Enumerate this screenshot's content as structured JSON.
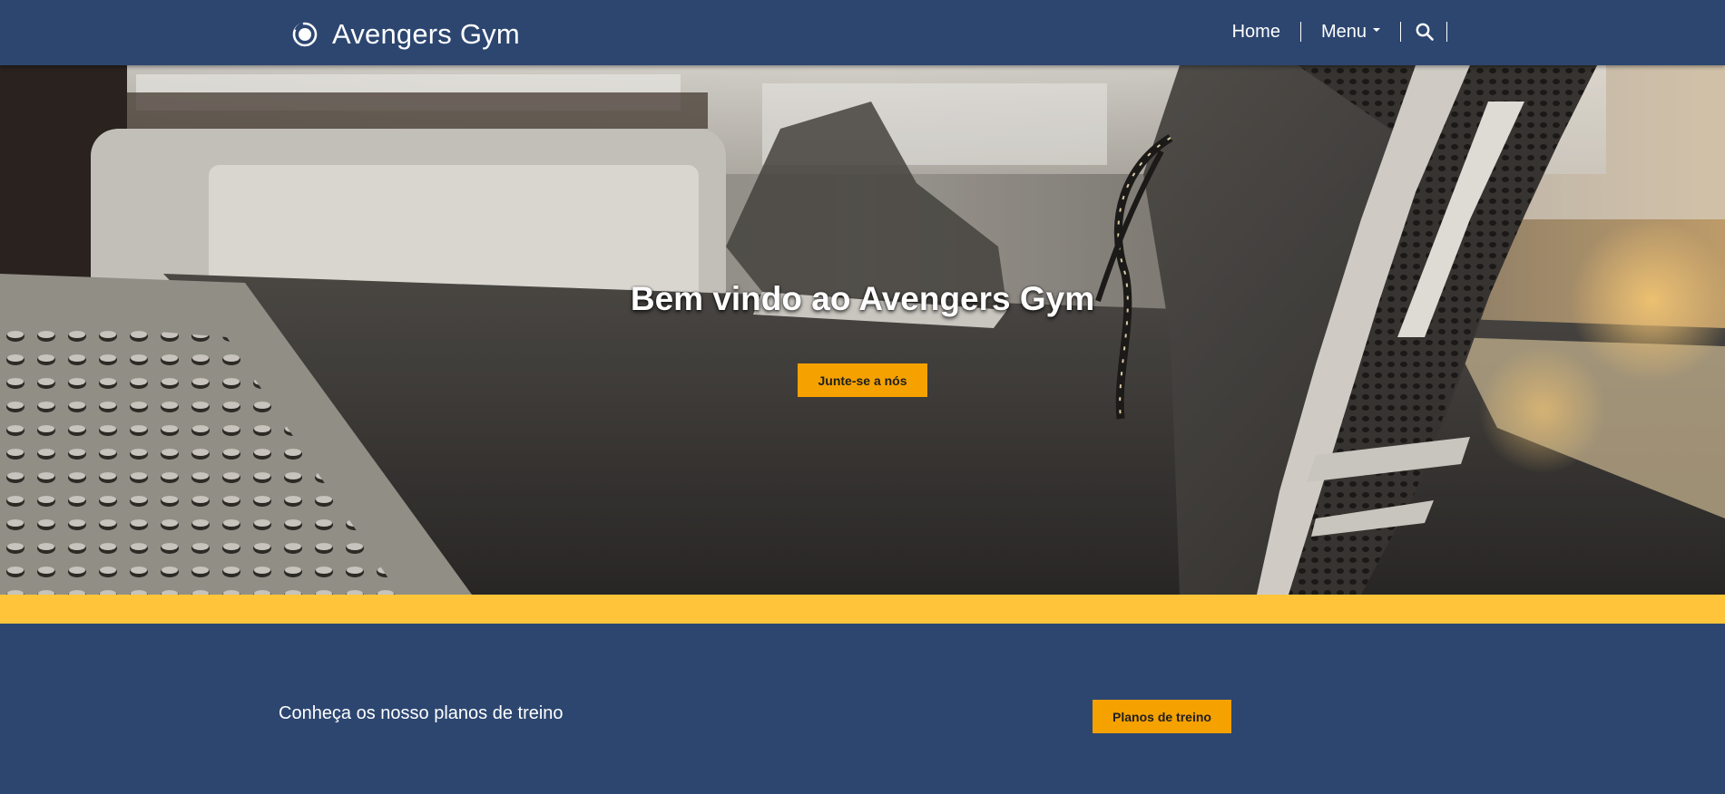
{
  "navbar": {
    "brand_name": "Avengers Gym",
    "logo_icon": "circle-logo-icon",
    "items": [
      {
        "label": "Home"
      },
      {
        "label": "Menu",
        "icon": "caret-down-icon"
      }
    ],
    "search_icon": "search-icon"
  },
  "hero": {
    "title": "Bem vindo ao Avengers Gym",
    "cta_label": "Junte-se a nós",
    "background": "treadmill-sneaker-photo"
  },
  "plans": {
    "text": "Conheça os nosso planos de treino",
    "cta_label": "Planos de treino"
  },
  "colors": {
    "navy": "#2c4670",
    "orange": "#f5a100",
    "yellow": "#ffc43a",
    "white": "#ffffff"
  }
}
